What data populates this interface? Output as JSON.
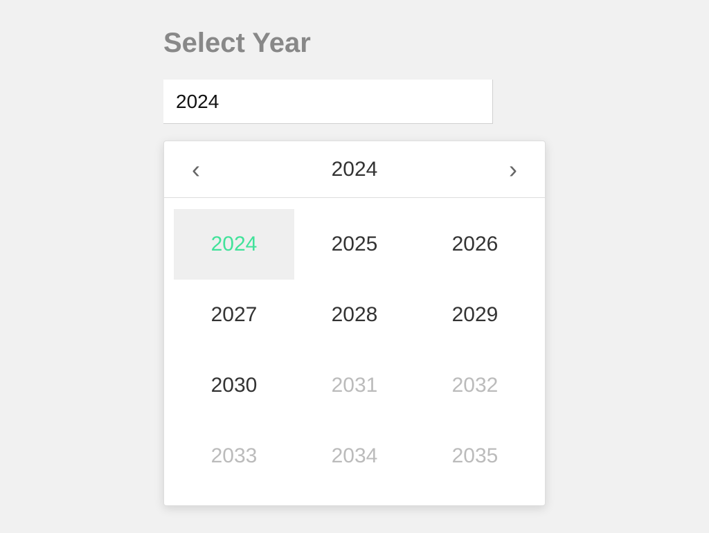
{
  "title": "Select Year",
  "input_value": "2024",
  "picker": {
    "header_year": "2024",
    "years": [
      {
        "label": "2024",
        "selected": true,
        "disabled": false
      },
      {
        "label": "2025",
        "selected": false,
        "disabled": false
      },
      {
        "label": "2026",
        "selected": false,
        "disabled": false
      },
      {
        "label": "2027",
        "selected": false,
        "disabled": false
      },
      {
        "label": "2028",
        "selected": false,
        "disabled": false
      },
      {
        "label": "2029",
        "selected": false,
        "disabled": false
      },
      {
        "label": "2030",
        "selected": false,
        "disabled": false
      },
      {
        "label": "2031",
        "selected": false,
        "disabled": true
      },
      {
        "label": "2032",
        "selected": false,
        "disabled": true
      },
      {
        "label": "2033",
        "selected": false,
        "disabled": true
      },
      {
        "label": "2034",
        "selected": false,
        "disabled": true
      },
      {
        "label": "2035",
        "selected": false,
        "disabled": true
      }
    ]
  },
  "colors": {
    "page_bg": "#f1f1f1",
    "title_gray": "#888888",
    "selected_bg": "#efefef",
    "selected_text": "#41e29a",
    "disabled_text": "#bbbbbb"
  }
}
